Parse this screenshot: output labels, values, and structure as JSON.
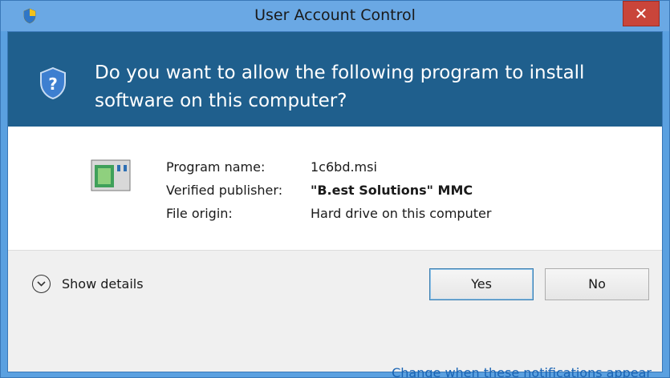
{
  "window": {
    "title": "User Account Control",
    "close_label": "✕"
  },
  "banner": {
    "question": "Do you want to allow the following program to install software on this computer?"
  },
  "program": {
    "rows": [
      {
        "label": "Program name:",
        "value": "1c6bd.msi"
      },
      {
        "label": "Verified publisher:",
        "value": "\"B.est Solutions\" MMC"
      },
      {
        "label": "File origin:",
        "value": "Hard drive on this computer"
      }
    ]
  },
  "footer": {
    "details_label": "Show details",
    "yes_label": "Yes",
    "no_label": "No",
    "link_label": "Change when these notifications appear"
  },
  "colors": {
    "banner": "#1f5f8d",
    "titlebar": "#6aa8e4",
    "close": "#c9453a",
    "link": "#1a64b4"
  },
  "icons": {
    "title": "uac-shield-icon",
    "banner": "question-shield-icon",
    "program": "program-window-icon",
    "details": "chevron-down-icon"
  }
}
